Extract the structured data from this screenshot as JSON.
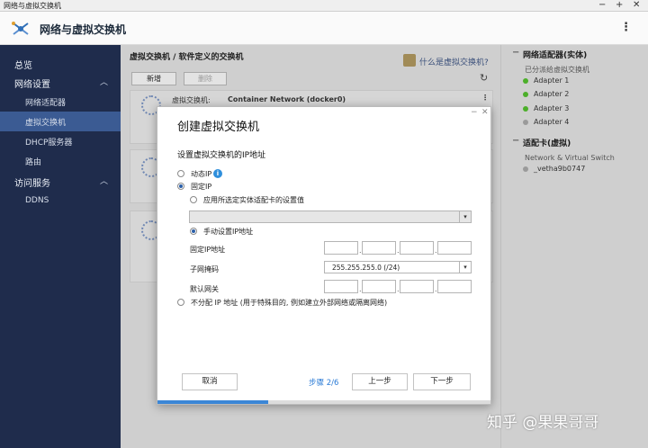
{
  "window": {
    "title": "网络与虚拟交换机",
    "controls": [
      "−",
      "+",
      "✕"
    ]
  },
  "app": {
    "title": "网络与虚拟交换机",
    "menu_glyph": "⋮"
  },
  "sidebar": {
    "items": [
      {
        "label": "总览",
        "level": "top"
      },
      {
        "label": "网络设置",
        "level": "top",
        "chevron": "︿"
      },
      {
        "label": "网络适配器",
        "level": "sub"
      },
      {
        "label": "虚拟交换机",
        "level": "sub",
        "active": true
      },
      {
        "label": "DHCP服务器",
        "level": "sub"
      },
      {
        "label": "路由",
        "level": "sub"
      },
      {
        "label": "访问服务",
        "level": "top",
        "chevron": "︿"
      },
      {
        "label": "DDNS",
        "level": "sub"
      }
    ]
  },
  "main": {
    "breadcrumb": "虚拟交换机 / 软件定义的交换机",
    "help_link": "什么是虚拟交换机?",
    "buttons": {
      "add": "新增",
      "delete": "删除"
    },
    "refresh_glyph": "↻",
    "row1": {
      "label": "虚拟交换机:",
      "value": "Container Network (docker0)"
    }
  },
  "right_panel": {
    "physical_title": "网络适配器(实体)",
    "assigned_label": "已分派给虚拟交换机",
    "adapters": [
      {
        "label": "Adapter 1",
        "status": "green"
      },
      {
        "label": "Adapter 2",
        "status": "green"
      },
      {
        "label": "Adapter 3",
        "status": "green"
      },
      {
        "label": "Adapter 4",
        "status": "gray"
      }
    ],
    "virtual_title": "适配卡(虚拟)",
    "virtual_sub": "Network & Virtual Switch",
    "virtual_items": [
      "_vetha9b0747"
    ]
  },
  "watermark": "知乎 @果果哥哥",
  "modal": {
    "title": "创建虚拟交换机",
    "subtitle": "设置虚拟交换机的IP地址",
    "opt_dynamic": "动态IP",
    "info_glyph": "i",
    "opt_static": "固定IP",
    "opt_use_physical": "应用所选定实体适配卡的设置值",
    "opt_manual": "手动设置IP地址",
    "field_ip": "固定IP地址",
    "field_mask": "子网掩码",
    "mask_value": "255.255.255.0 (/24)",
    "field_gateway": "默认网关",
    "opt_none": "不分配 IP 地址 (用于特殊目的, 例如建立外部网络或隔离网络)",
    "ip_values": [
      "",
      "",
      "",
      ""
    ],
    "gateway_values": [
      "",
      "",
      "",
      ""
    ],
    "btn_cancel": "取消",
    "step": "步骤 2/6",
    "btn_prev": "上一步",
    "btn_next": "下一步",
    "progress_fraction": 0.333,
    "ctrl_min": "−",
    "ctrl_close": "✕"
  },
  "colors": {
    "sidebar": "#1f2c4c",
    "sidebar_active": "#3b5b93",
    "accent_blue": "#2b7bd6",
    "status_green": "#4caf2a",
    "status_gray": "#9a9a9a"
  }
}
